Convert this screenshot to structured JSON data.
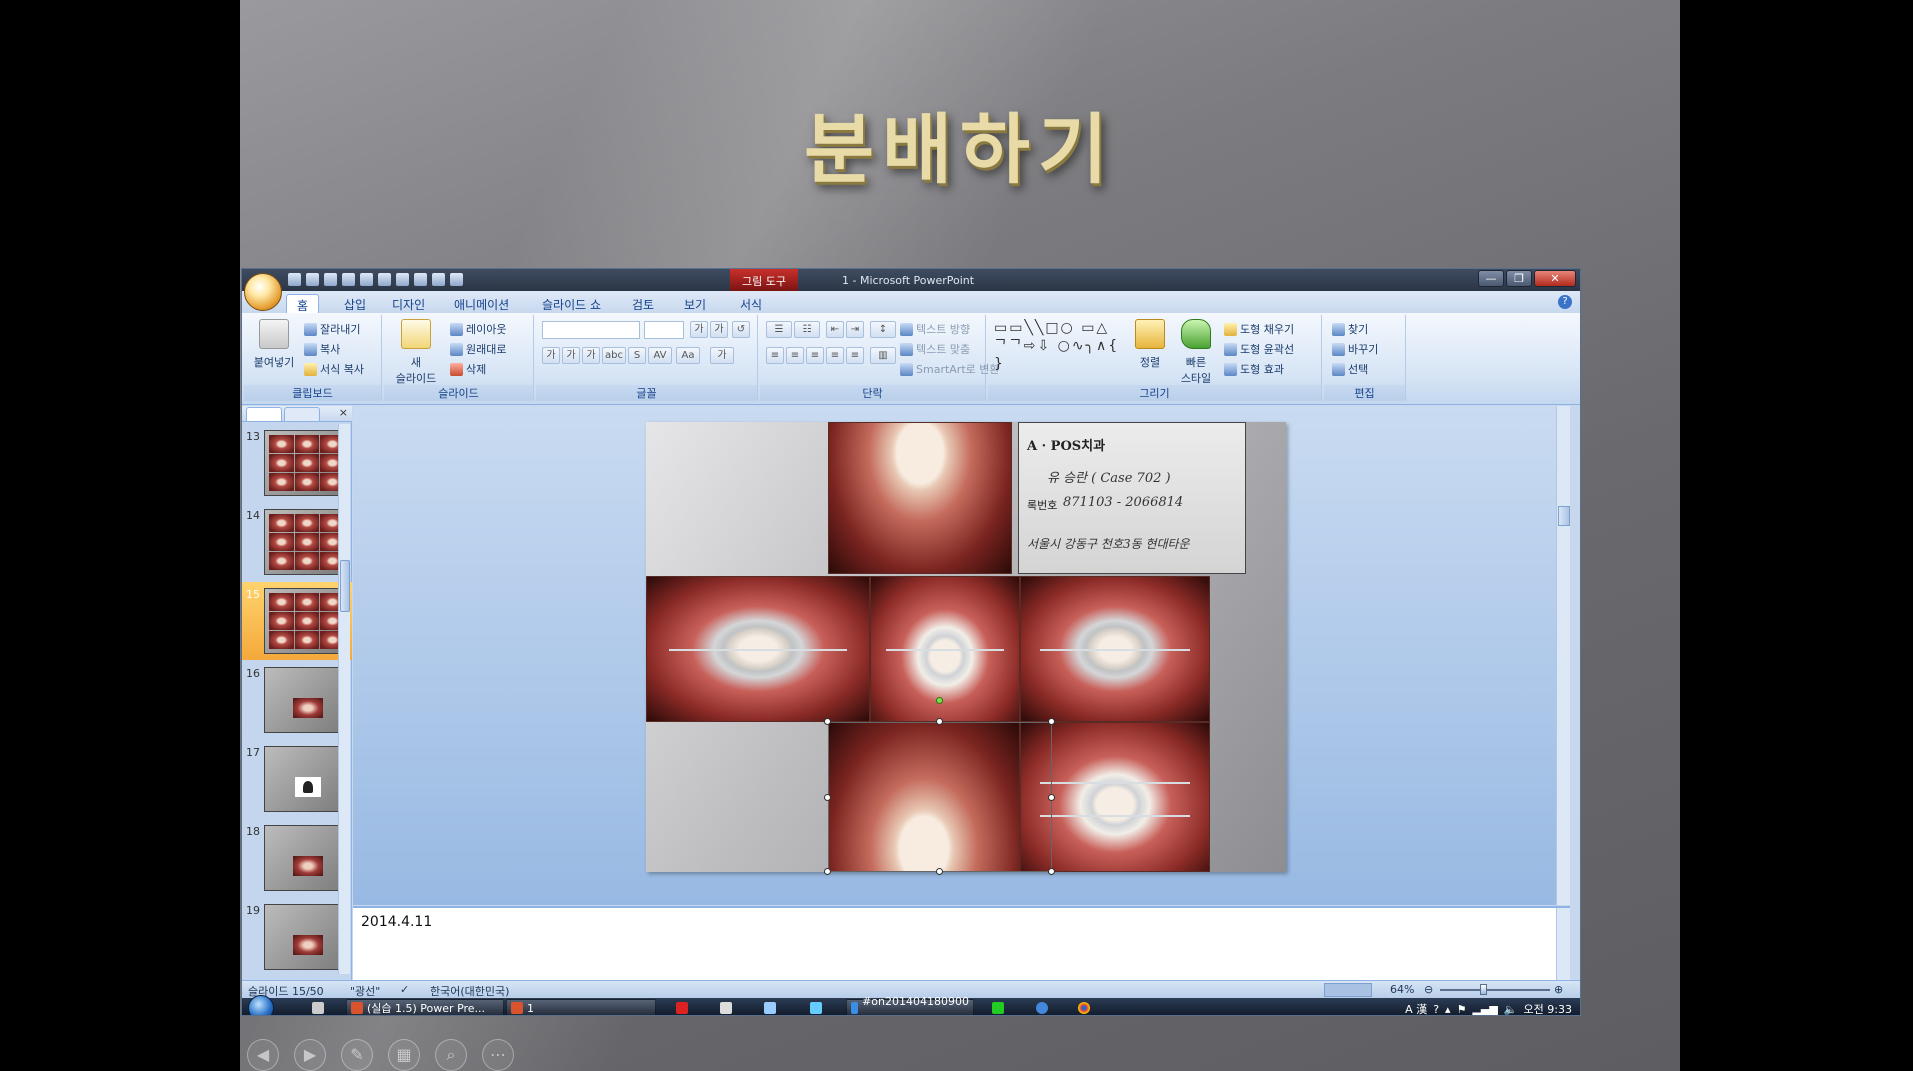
{
  "slide": {
    "title": "분배하기"
  },
  "window": {
    "title": "1 - Microsoft PowerPoint",
    "context_tab": "그림 도구",
    "controls": [
      "—",
      "❐",
      "✕"
    ]
  },
  "ribbon_tabs": [
    "홈",
    "삽입",
    "디자인",
    "애니메이션",
    "슬라이드 쇼",
    "검토",
    "보기",
    "서식"
  ],
  "ribbon": {
    "clipboard": {
      "label": "클립보드",
      "paste": "붙여넣기",
      "cut": "잘라내기",
      "copy": "복사",
      "format_painter": "서식 복사"
    },
    "slides": {
      "label": "슬라이드",
      "new_slide": "새\n슬라이드",
      "layout": "레이아웃",
      "reset": "원래대로",
      "delete": "삭제"
    },
    "font": {
      "label": "글꼴",
      "bold": "가",
      "italic": "가",
      "underline": "가",
      "strike": "abc",
      "shadow": "S",
      "spacing": "AV",
      "case": "Aa",
      "color": "가"
    },
    "paragraph": {
      "label": "단락",
      "text_direction": "텍스트 방향",
      "align_text": "텍스트 맞춤",
      "smartart": "SmartArt로 변환"
    },
    "drawing": {
      "label": "그리기",
      "arrange": "정렬",
      "quick_styles": "빠른\n스타일",
      "shape_fill": "도형 채우기",
      "shape_outline": "도형 윤곽선",
      "shape_effects": "도형 효과"
    },
    "editing": {
      "label": "편집",
      "find": "찾기",
      "replace": "바꾸기",
      "select": "선택"
    }
  },
  "thumbnails": [
    {
      "num": "13",
      "kind": "grid"
    },
    {
      "num": "14",
      "kind": "grid"
    },
    {
      "num": "15",
      "kind": "grid",
      "selected": true
    },
    {
      "num": "16",
      "kind": "single"
    },
    {
      "num": "17",
      "kind": "dark"
    },
    {
      "num": "18",
      "kind": "single"
    },
    {
      "num": "19",
      "kind": "single"
    }
  ],
  "card": {
    "line1": "A · POS치과",
    "line2": "유 승란 ( Case 702 )",
    "line3_label": "록번호",
    "line3_value": "871103 - 2066814",
    "line4": "서울시 강동구 천호3동 현대타운"
  },
  "notes": {
    "text": "2014.4.11"
  },
  "status": {
    "slide_info": "슬라이드 15/50",
    "theme": "\"광선\"",
    "language": "한국어(대한민국)",
    "zoom": "64%",
    "zoom_level": 0.64
  },
  "taskbar": {
    "items": [
      "(실습 1.5) Power Pre...",
      "1",
      "#on201404180900 ..."
    ],
    "tray_ime": "A 漢",
    "clock": "오전 9:33"
  },
  "slideshow_nav": [
    "previous-icon",
    "next-icon",
    "pen-icon",
    "slides-icon",
    "zoom-icon",
    "more-icon"
  ]
}
